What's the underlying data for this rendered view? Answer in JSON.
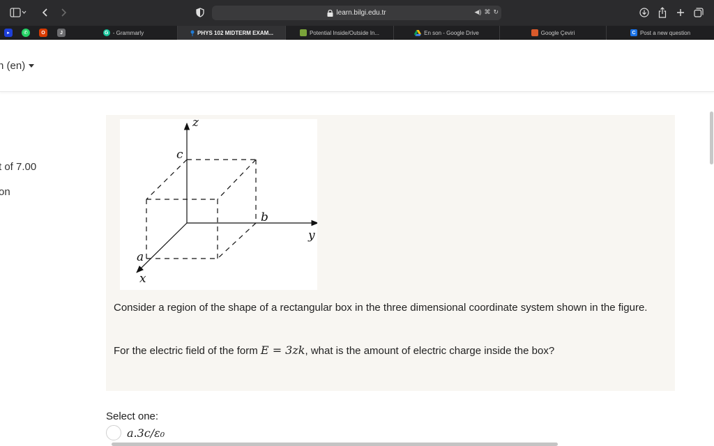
{
  "browser": {
    "address": "learn.bilgi.edu.tr",
    "tabs": [
      {
        "label": "- Grammarly",
        "favicon_color": "#15c39a",
        "favicon_glyph": "G",
        "active": false
      },
      {
        "label": "PHYS 102 MIDTERM EXAM...",
        "favicon_color": "#1f7bd6",
        "favicon_glyph": "",
        "active": true
      },
      {
        "label": "Potential Inside/Outside In...",
        "favicon_color": "#7aa33a",
        "favicon_glyph": "",
        "active": false
      },
      {
        "label": "En son - Google Drive",
        "favicon_color": "#2a9d4b",
        "favicon_glyph": "",
        "active": false
      },
      {
        "label": "Google Çeviri",
        "favicon_color": "#d95a2b",
        "favicon_glyph": "",
        "active": false
      },
      {
        "label": "Post a new question",
        "favicon_color": "#1a73e8",
        "favicon_glyph": "C",
        "active": false
      }
    ],
    "pinned_glyphs": [
      "",
      "",
      "O",
      "J"
    ]
  },
  "page": {
    "language": "n (en)",
    "side_grade": "t of 7.00",
    "side_status": "on"
  },
  "figure": {
    "axis_z": "z",
    "axis_y": "y",
    "axis_x": "x",
    "label_a": "a",
    "label_b": "b",
    "label_c": "c"
  },
  "question": {
    "paragraph1": "Consider a region of the shape of a rectangular box in the three dimensional coordinate system shown in the figure.",
    "p2_prefix": "For the electric field of the form",
    "p2_formula": "E = 3zk",
    "p2_suffix": ", what is the amount of electric charge inside the box?",
    "select_one": "Select one:",
    "option_a": "a.3c/ε₀"
  }
}
